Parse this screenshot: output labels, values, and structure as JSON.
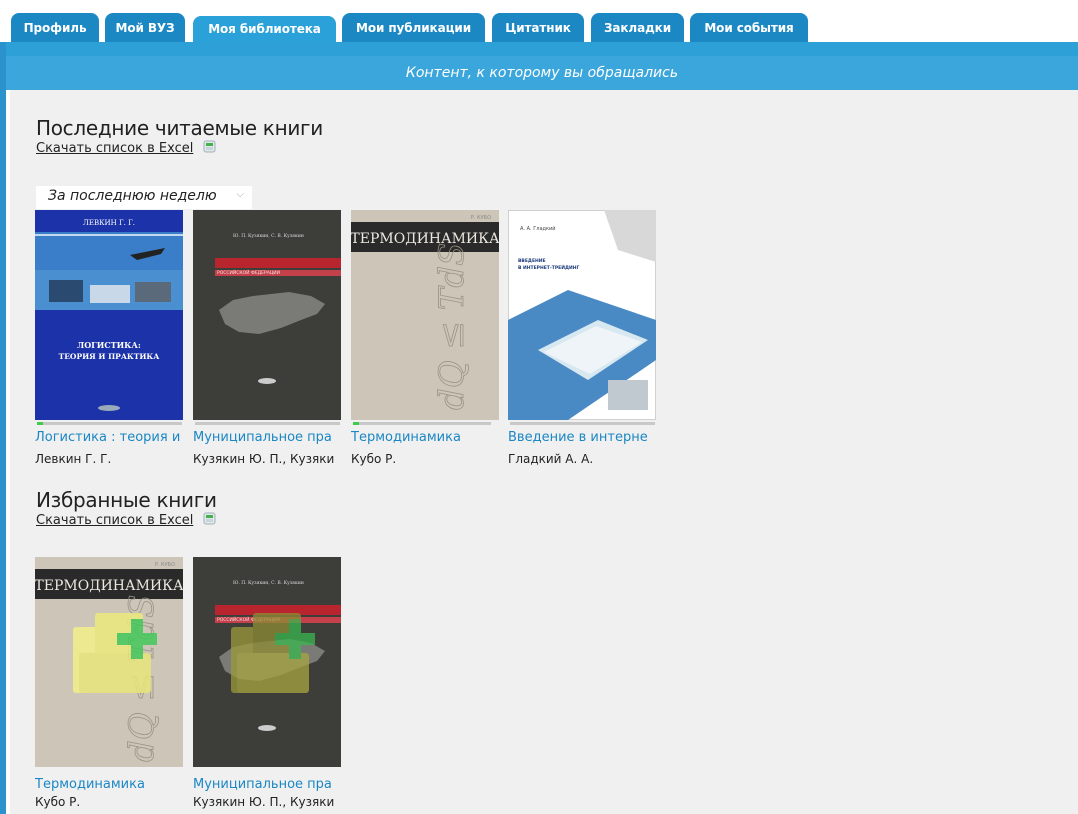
{
  "tabs": [
    {
      "label": "Профиль"
    },
    {
      "label": "Мой ВУЗ"
    },
    {
      "label": "Моя библиотека",
      "active": true
    },
    {
      "label": "Мои публикации"
    },
    {
      "label": "Цитатник"
    },
    {
      "label": "Закладки"
    },
    {
      "label": "Мои события"
    }
  ],
  "banner": "Контент, к которому вы обращались",
  "recent": {
    "heading": "Последние читаемые книги",
    "excel_link": "Скачать список в Excel",
    "period": "За последнюю неделю",
    "books": [
      {
        "title": "Логистика : теория и",
        "author": "Левкин Г. Г.",
        "progress": 0.04,
        "cover": {
          "author_text": "ЛЕВКИН Г. Г.",
          "title_line1": "ЛОГИСТИКА:",
          "title_line2": "ТЕОРИЯ И ПРАКТИКА"
        }
      },
      {
        "title": "Муниципальное пра",
        "author": "Кузякин Ю. П., Кузяки",
        "progress": 0.0,
        "cover": {
          "author_text": "Ю. П. Кузякин, С. В. Кузякин",
          "subtitle": "РОССИЙСКОЙ ФЕДЕРАЦИИ"
        }
      },
      {
        "title": "Термодинамика",
        "author": "Кубо Р.",
        "progress": 0.04,
        "cover": {
          "author_text": "Р. КУБО",
          "title_text": "ТЕРМОДИНАМИКА",
          "formula": "dQ ≤ TdS"
        }
      },
      {
        "title": "Введение в интерне",
        "author": "Гладкий А. А.",
        "progress": 0.0,
        "cover": {
          "author_text": "А. А. Гладкий",
          "title_line1": "ВВЕДЕНИЕ",
          "title_line2": "В ИНТЕРНЕТ-ТРЕЙДИНГ"
        }
      }
    ]
  },
  "favorites": {
    "heading": "Избранные книги",
    "excel_link": "Скачать список в Excel",
    "books": [
      {
        "title": "Термодинамика",
        "author": "Кубо Р.",
        "cover": {
          "author_text": "Р. КУБО",
          "title_text": "ТЕРМОДИНАМИКА"
        }
      },
      {
        "title": "Муниципальное пра",
        "author": "Кузякин Ю. П., Кузяки",
        "cover": {
          "author_text": "Ю. П. Кузякин, С. В. Кузякин",
          "subtitle": "РОССИЙСКОЙ ФЕДЕРАЦИИ"
        }
      }
    ]
  },
  "colors": {
    "tab": "#1b88c4",
    "tab_active": "#2aa1d8",
    "band": "#2ea0d8",
    "link": "#1a87c5",
    "progress_fill": "#3fcc4a"
  },
  "icons": [
    "excel-icon",
    "chevron-down-icon",
    "add-to-favorites-icon"
  ]
}
